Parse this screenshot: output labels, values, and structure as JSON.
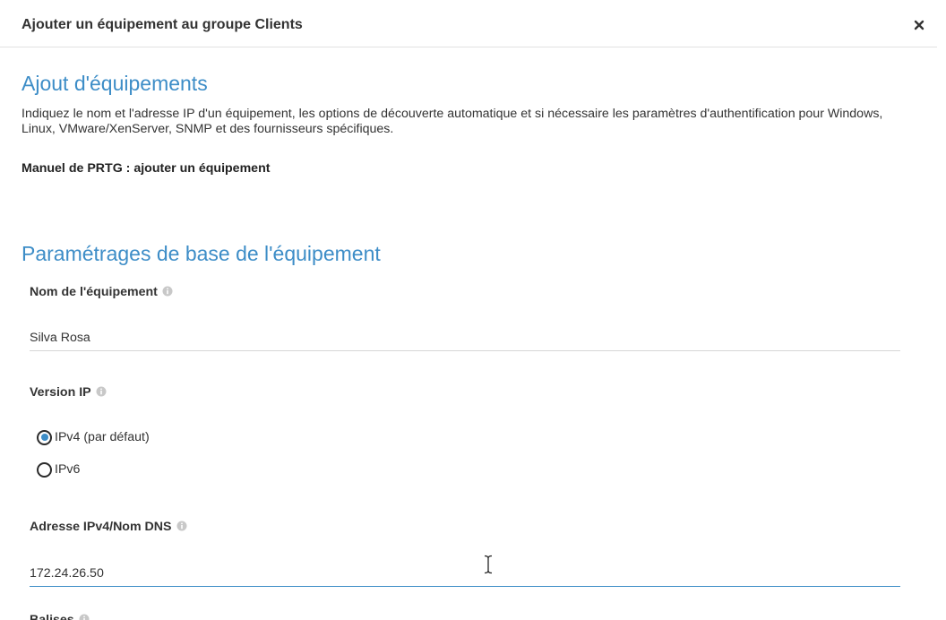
{
  "dialog": {
    "title": "Ajouter un équipement au groupe Clients",
    "close_label": "×"
  },
  "intro": {
    "heading": "Ajout d'équipements",
    "description": "Indiquez le nom et l'adresse IP d'un équipement, les options de découverte automatique et si nécessaire les paramètres d'authentification pour Windows, Linux, VMware/XenServer, SNMP et des fournisseurs spécifiques.",
    "manual_link": "Manuel de PRTG : ajouter un équipement"
  },
  "basic_settings": {
    "heading": "Paramétrages de base de l'équipement",
    "device_name": {
      "label": "Nom de l'équipement",
      "value": "Silva Rosa"
    },
    "ip_version": {
      "label": "Version IP",
      "options": [
        "IPv4 (par défaut)",
        "IPv6"
      ],
      "selected": "IPv4 (par défaut)"
    },
    "ipv4_address": {
      "label": "Adresse IPv4/Nom DNS",
      "value": "172.24.26.50"
    },
    "next_field_label": "Balises"
  },
  "colors": {
    "accent": "#3d8dc7",
    "text": "#333333",
    "info_icon": "#c8c8c8",
    "divider": "#e2e2e2"
  },
  "icons": {
    "close": "close-icon",
    "info": "info-icon",
    "cursor": "text-cursor-icon"
  }
}
